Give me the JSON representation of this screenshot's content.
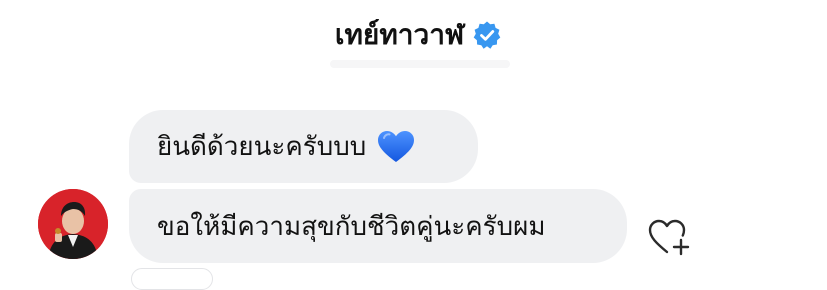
{
  "header": {
    "contact_name": "เทย์ทาวาฬ",
    "verified_icon": "verified-badge-icon"
  },
  "messages": [
    {
      "text": "ยินดีด้วยนะครับบบ",
      "emoji_icon": "blue-heart-emoji-icon"
    },
    {
      "text": "ขอให้มีความสุขกับชีวิตคู่นะครับผม"
    }
  ],
  "colors": {
    "bubble_background": "#eff0f2",
    "verified_blue": "#3897f0",
    "emoji_blue": "#1e6ff0",
    "avatar_background": "#d8232a"
  },
  "icons": {
    "like_icon": "heart-plus-icon",
    "avatar": "sender-avatar"
  }
}
